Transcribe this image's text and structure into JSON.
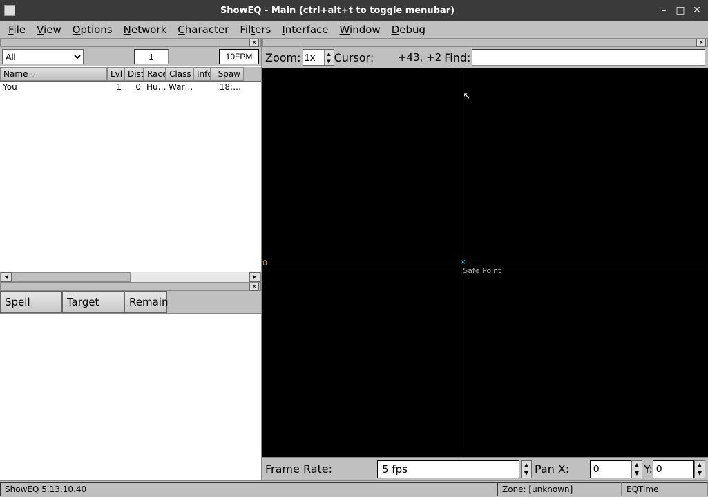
{
  "window": {
    "title": "ShowEQ - Main (ctrl+alt+t to toggle menubar)"
  },
  "menubar": [
    "File",
    "View",
    "Options",
    "Network",
    "Character",
    "Filters",
    "Interface",
    "Window",
    "Debug"
  ],
  "left_toolbar": {
    "filter_dropdown": "All",
    "count_input": "1",
    "fpm": "10FPM"
  },
  "spawn_table": {
    "headers": [
      "Name",
      "Lvl",
      "Dist",
      "Race",
      "Class",
      "Info",
      "Spaw"
    ],
    "rows": [
      {
        "name": "You",
        "lvl": "1",
        "dist": "0",
        "race": "Hu…",
        "class": "War…",
        "info": "",
        "spawn": "18:…"
      }
    ]
  },
  "spell_table": {
    "headers": [
      "Spell",
      "Target",
      "Remain"
    ]
  },
  "map_toolbar": {
    "zoom_label": "Zoom:",
    "zoom_value": "1x",
    "cursor_label": "Cursor:",
    "cursor_value": "+43,     +2",
    "find_label": "Find:",
    "find_value": ""
  },
  "map": {
    "origin_label": "0",
    "safe_point_label": "Safe Point"
  },
  "map_bottom": {
    "framerate_label": "Frame Rate:",
    "fps_value": "5 fps",
    "panx_label": "Pan X:",
    "panx_value": "0",
    "pany_label": "Y:",
    "pany_value": "0"
  },
  "statusbar": {
    "version": "ShowEQ 5.13.10.40",
    "zone": "Zone: [unknown]",
    "eqtime": "EQTime"
  }
}
